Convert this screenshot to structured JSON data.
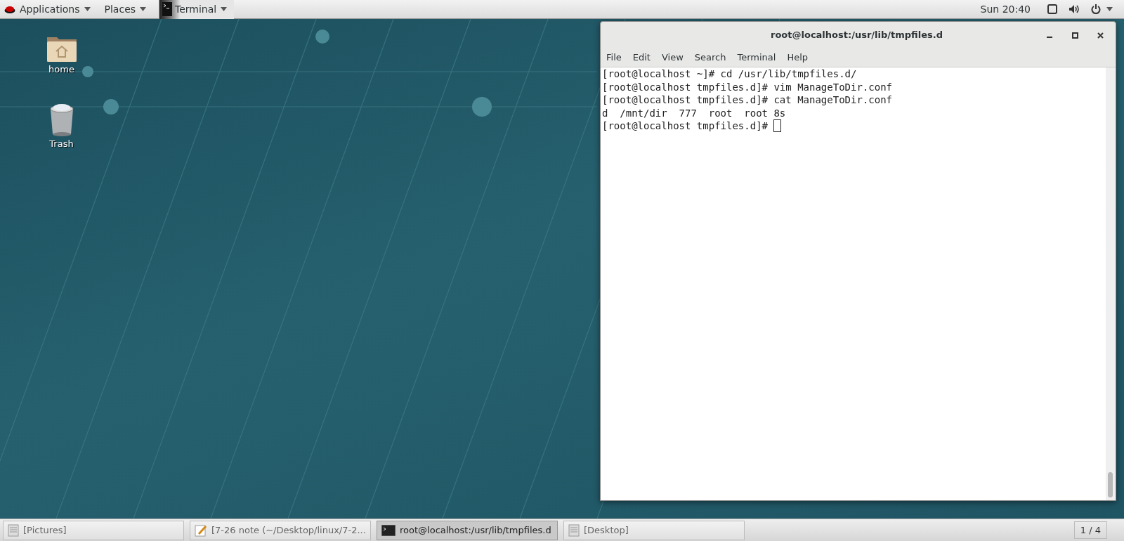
{
  "top_bar": {
    "menus": [
      {
        "label": "Applications",
        "kind": "logo"
      },
      {
        "label": "Places",
        "kind": "plain"
      }
    ],
    "active_app": {
      "label": "Terminal"
    },
    "clock": "Sun 20:40"
  },
  "desktop_icons": [
    {
      "label": "home",
      "kind": "folder"
    },
    {
      "label": "Trash",
      "kind": "trash"
    }
  ],
  "terminal_window": {
    "title": "root@localhost:/usr/lib/tmpfiles.d",
    "menu": [
      "File",
      "Edit",
      "View",
      "Search",
      "Terminal",
      "Help"
    ],
    "lines": [
      "[root@localhost ~]# cd /usr/lib/tmpfiles.d/",
      "[root@localhost tmpfiles.d]# vim ManageToDir.conf",
      "[root@localhost tmpfiles.d]# cat ManageToDir.conf",
      "d  /mnt/dir  777  root  root 8s",
      "[root@localhost tmpfiles.d]# "
    ],
    "cursor": true
  },
  "taskbar": {
    "tasks": [
      {
        "label": "[Pictures]",
        "kind": "document",
        "selected": false
      },
      {
        "label": "[7-26 note (~/Desktop/linux/7-2...",
        "kind": "editor",
        "selected": false
      },
      {
        "label": "root@localhost:/usr/lib/tmpfiles.d",
        "kind": "terminal",
        "selected": true
      },
      {
        "label": "[Desktop]",
        "kind": "document",
        "selected": false
      }
    ],
    "workspace": "1 / 4"
  }
}
